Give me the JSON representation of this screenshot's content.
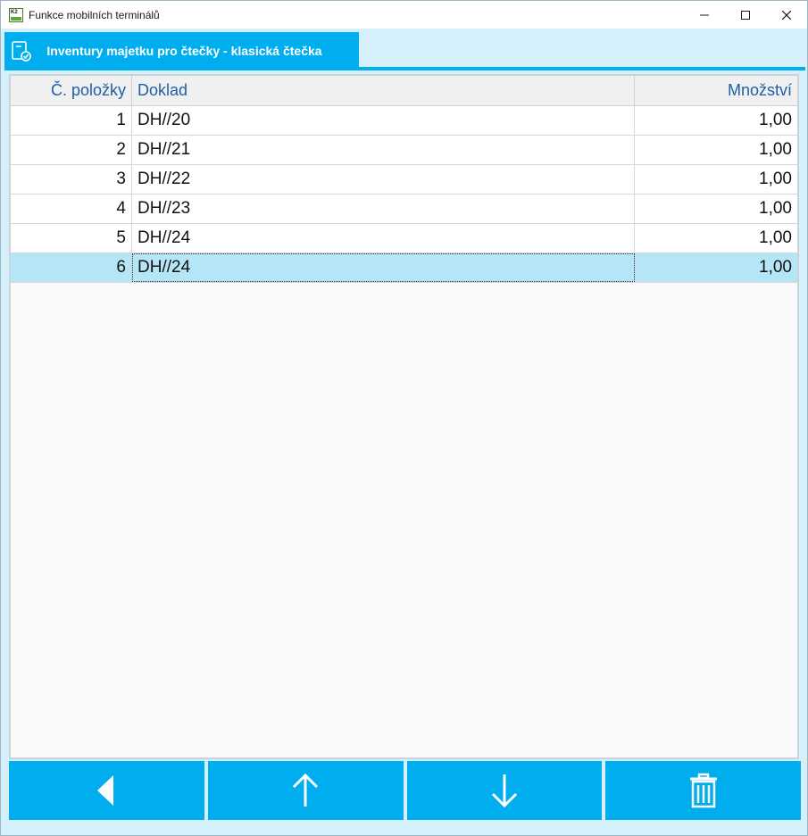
{
  "window": {
    "title": "Funkce mobilních terminálů",
    "app_icon_text": "K2"
  },
  "tabs": [
    {
      "label": "Inventury majetku pro čtečky - klasická čtečka",
      "active": true
    }
  ],
  "grid": {
    "columns": [
      "Č. položky",
      "Doklad",
      "Množství"
    ],
    "rows": [
      {
        "num": "1",
        "doc": "DH//20",
        "qty": "1,00"
      },
      {
        "num": "2",
        "doc": "DH//21",
        "qty": "1,00"
      },
      {
        "num": "3",
        "doc": "DH//22",
        "qty": "1,00"
      },
      {
        "num": "4",
        "doc": "DH//23",
        "qty": "1,00"
      },
      {
        "num": "5",
        "doc": "DH//24",
        "qty": "1,00"
      },
      {
        "num": "6",
        "doc": "DH//24",
        "qty": "1,00"
      }
    ],
    "selected_row": 6
  },
  "buttons": [
    {
      "name": "back-button",
      "icon": "triangle-left-icon"
    },
    {
      "name": "up-button",
      "icon": "arrow-up-icon"
    },
    {
      "name": "down-button",
      "icon": "arrow-down-icon"
    },
    {
      "name": "delete-button",
      "icon": "trash-icon"
    }
  ],
  "colors": {
    "accent": "#00aeef",
    "background": "#d6f0fb",
    "selected_row": "#b5e6f7",
    "header_text": "#1f5fa8"
  }
}
